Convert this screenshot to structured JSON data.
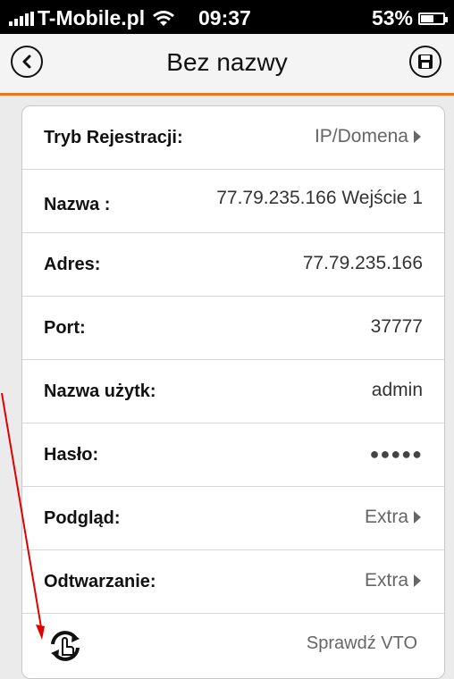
{
  "status_bar": {
    "carrier": "T-Mobile.pl",
    "time": "09:37",
    "battery": "53%",
    "battery_level": 0.53
  },
  "nav": {
    "title": "Bez nazwy",
    "back_icon": "back-circle-icon",
    "save_icon": "save-disk-icon"
  },
  "rows": {
    "mode": {
      "label": "Tryb Rejestracji:",
      "value": "IP/Domena"
    },
    "name": {
      "label": "Nazwa :",
      "value": "77.79.235.166 Wejście 1"
    },
    "address": {
      "label": "Adres:",
      "value": "77.79.235.166"
    },
    "port": {
      "label": "Port:",
      "value": "37777"
    },
    "username": {
      "label": "Nazwa użytk:",
      "value": "admin"
    },
    "password": {
      "label": "Hasło:",
      "value": "●●●●●"
    },
    "preview": {
      "label": "Podgląd:",
      "value": "Extra"
    },
    "playback": {
      "label": "Odtwarzanie:",
      "value": "Extra"
    }
  },
  "footer": {
    "label": "Sprawdź VTO",
    "icon": "refresh-hand-icon"
  },
  "colors": {
    "accent": "#e6781e",
    "annotation": "#e00000"
  }
}
